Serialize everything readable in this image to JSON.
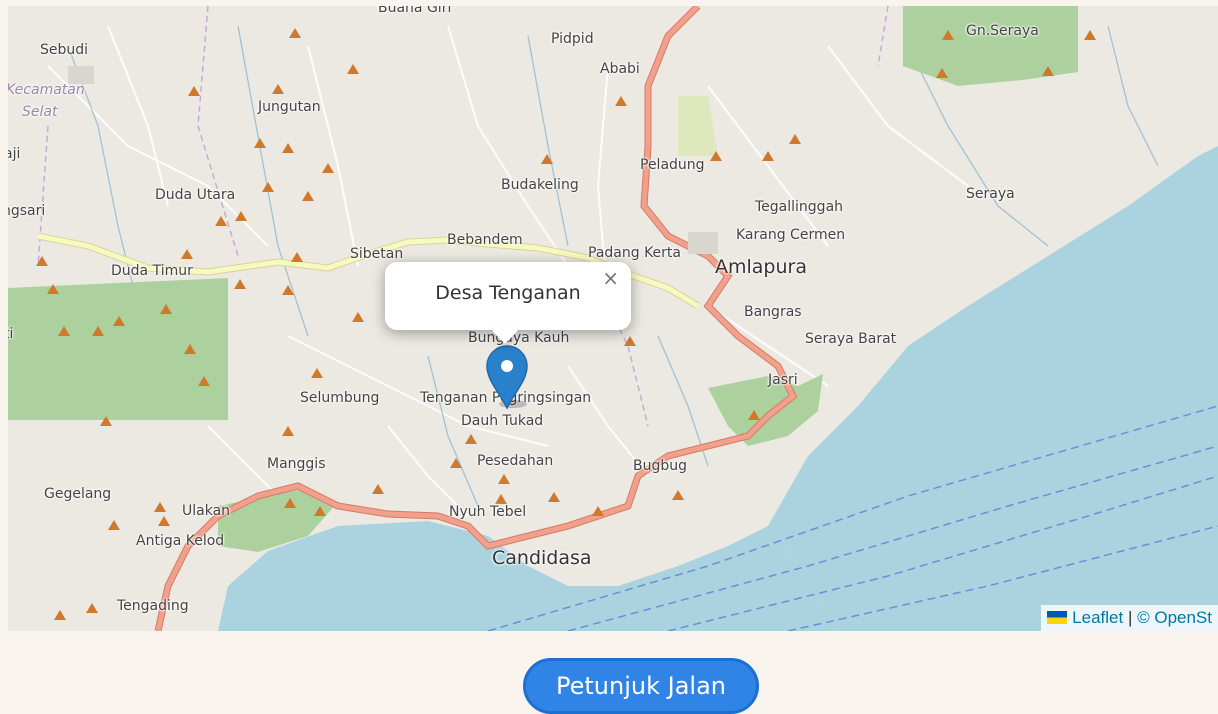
{
  "map": {
    "popup": {
      "title": "Desa Tenganan",
      "close": "×"
    },
    "labels": {
      "buana_giri": "Buana Giri",
      "sebudi": "Sebudi",
      "kecamatan_selat_1": "Kecamatan",
      "kecamatan_selat_2": "Selat",
      "jungutan": "Jungutan",
      "pidpid": "Pidpid",
      "ababi": "Ababi",
      "gn_seraya": "Gn.Seraya",
      "peladung": "Peladung",
      "budakeling": "Budakeling",
      "duda_utara": "Duda Utara",
      "tegallinggah": "Tegallinggah",
      "seraya": "Seraya",
      "karang_cermen": "Karang Cermen",
      "bebandem": "Bebandem",
      "sibetan": "Sibetan",
      "padang_kerta": "Padang Kerta",
      "amlapura": "Amlapura",
      "duda_timur": "Duda Timur",
      "bangras": "Bangras",
      "bungaya_kauh": "Bungaya Kauh",
      "seraya_barat": "Seraya Barat",
      "jasri": "Jasri",
      "selumbung": "Selumbung",
      "tenganan_pegringsingan": "Tenganan Pegringsingan",
      "dauh_tukad": "Dauh Tukad",
      "manggis": "Manggis",
      "pesedahan": "Pesedahan",
      "bugbug": "Bugbug",
      "gegelang": "Gegelang",
      "ulakan": "Ulakan",
      "nyuh_tebel": "Nyuh Tebel",
      "antiga_kelod": "Antiga Kelod",
      "candidasa": "Candidasa",
      "tengading": "Tengading",
      "ngsari": "ngsari",
      "aji": "aji",
      "ti": "ti"
    },
    "attribution": {
      "leaflet": "Leaflet",
      "separator": "|",
      "osm": "© OpenSt"
    }
  },
  "actions": {
    "directions_label": "Petunjuk Jalan"
  },
  "colors": {
    "sea": "#aad3df",
    "forest": "#add19e",
    "primary_road": "#e8927c",
    "secondary_road": "#f7fabf",
    "marker": "#2a81cb",
    "button": "#2f84e6"
  }
}
